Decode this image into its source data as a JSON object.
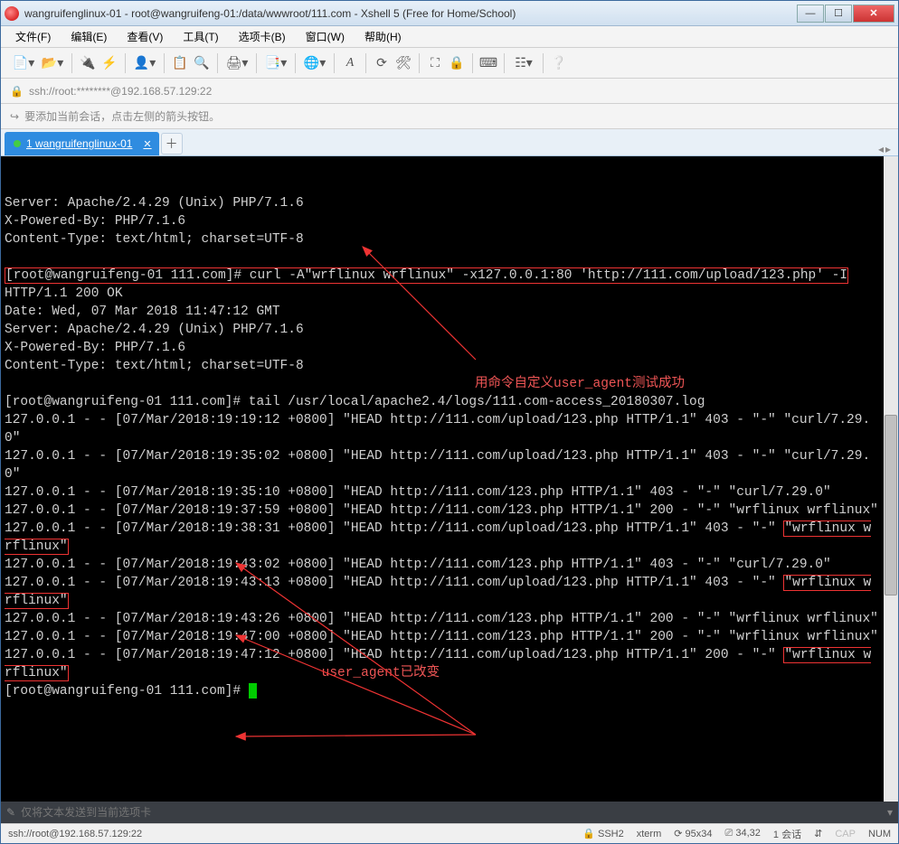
{
  "window": {
    "title": "wangruifenglinux-01 - root@wangruifeng-01:/data/wwwroot/111.com - Xshell 5 (Free for Home/School)"
  },
  "menu": {
    "file": "文件(F)",
    "edit": "编辑(E)",
    "view": "查看(V)",
    "tools": "工具(T)",
    "tabs": "选项卡(B)",
    "window": "窗口(W)",
    "help": "帮助(H)"
  },
  "addrbar": {
    "url": "ssh://root:********@192.168.57.129:22"
  },
  "hint": {
    "text": "要添加当前会话，点击左侧的箭头按钮。"
  },
  "tabs": {
    "main": "1 wangruifenglinux-01"
  },
  "terminal": {
    "l1": "Server: Apache/2.4.29 (Unix) PHP/7.1.6",
    "l2": "X-Powered-By: PHP/7.1.6",
    "l3": "Content-Type: text/html; charset=UTF-8",
    "cmd1": "[root@wangruifeng-01 111.com]# curl -A\"wrflinux wrflinux\" -x127.0.0.1:80 'http://111.com/upload/123.php' -I",
    "l5": "HTTP/1.1 200 OK",
    "l6": "Date: Wed, 07 Mar 2018 11:47:12 GMT",
    "l7": "Server: Apache/2.4.29 (Unix) PHP/7.1.6",
    "l8": "X-Powered-By: PHP/7.1.6",
    "l9": "Content-Type: text/html; charset=UTF-8",
    "anno1": "用命令自定义user_agent测试成功",
    "cmd2": "[root@wangruifeng-01 111.com]# tail /usr/local/apache2.4/logs/111.com-access_20180307.log",
    "log1": "127.0.0.1 - - [07/Mar/2018:19:19:12 +0800] \"HEAD http://111.com/upload/123.php HTTP/1.1\" 403 - \"-\" \"curl/7.29.0\"",
    "log2": "127.0.0.1 - - [07/Mar/2018:19:35:02 +0800] \"HEAD http://111.com/upload/123.php HTTP/1.1\" 403 - \"-\" \"curl/7.29.0\"",
    "log3": "127.0.0.1 - - [07/Mar/2018:19:35:10 +0800] \"HEAD http://111.com/123.php HTTP/1.1\" 403 - \"-\" \"curl/7.29.0\"",
    "log4": "127.0.0.1 - - [07/Mar/2018:19:37:59 +0800] \"HEAD http://111.com/123.php HTTP/1.1\" 200 - \"-\" \"wrflinux wrflinux\"",
    "log5a": "127.0.0.1 - - [07/Mar/2018:19:38:31 +0800] \"HEAD http://111.com/upload/123.php HTTP/1.1\" 403 - \"-\" ",
    "log5b": "\"wrflinux wrflinux\"",
    "log6": "127.0.0.1 - - [07/Mar/2018:19:43:02 +0800] \"HEAD http://111.com/123.php HTTP/1.1\" 403 - \"-\" \"curl/7.29.0\"",
    "log7a": "127.0.0.1 - - [07/Mar/2018:19:43:13 +0800] \"HEAD http://111.com/upload/123.php HTTP/1.1\" 403 - \"-\" ",
    "log7b": "\"wrflinux wrflinux\"",
    "log8": "127.0.0.1 - - [07/Mar/2018:19:43:26 +0800] \"HEAD http://111.com/123.php HTTP/1.1\" 200 - \"-\" \"wrflinux wrflinux\"",
    "log9": "127.0.0.1 - - [07/Mar/2018:19:47:00 +0800] \"HEAD http://111.com/123.php HTTP/1.1\" 200 - \"-\" \"wrflinux wrflinux\"",
    "log10a": "127.0.0.1 - - [07/Mar/2018:19:47:12 +0800] \"HEAD http://111.com/upload/123.php HTTP/1.1\" 200 - \"-\" ",
    "log10b": "\"wrflinux wrflinux\"",
    "anno2": "user_agent已改变",
    "prompt": "[root@wangruifeng-01 111.com]# "
  },
  "sendbar": {
    "placeholder": "仅将文本发送到当前选项卡"
  },
  "status": {
    "conn": "ssh://root@192.168.57.129:22",
    "ssh": "SSH2",
    "term": "xterm",
    "size": "95x34",
    "pos": "34,32",
    "sess": "1 会话",
    "cap": "CAP",
    "num": "NUM"
  }
}
